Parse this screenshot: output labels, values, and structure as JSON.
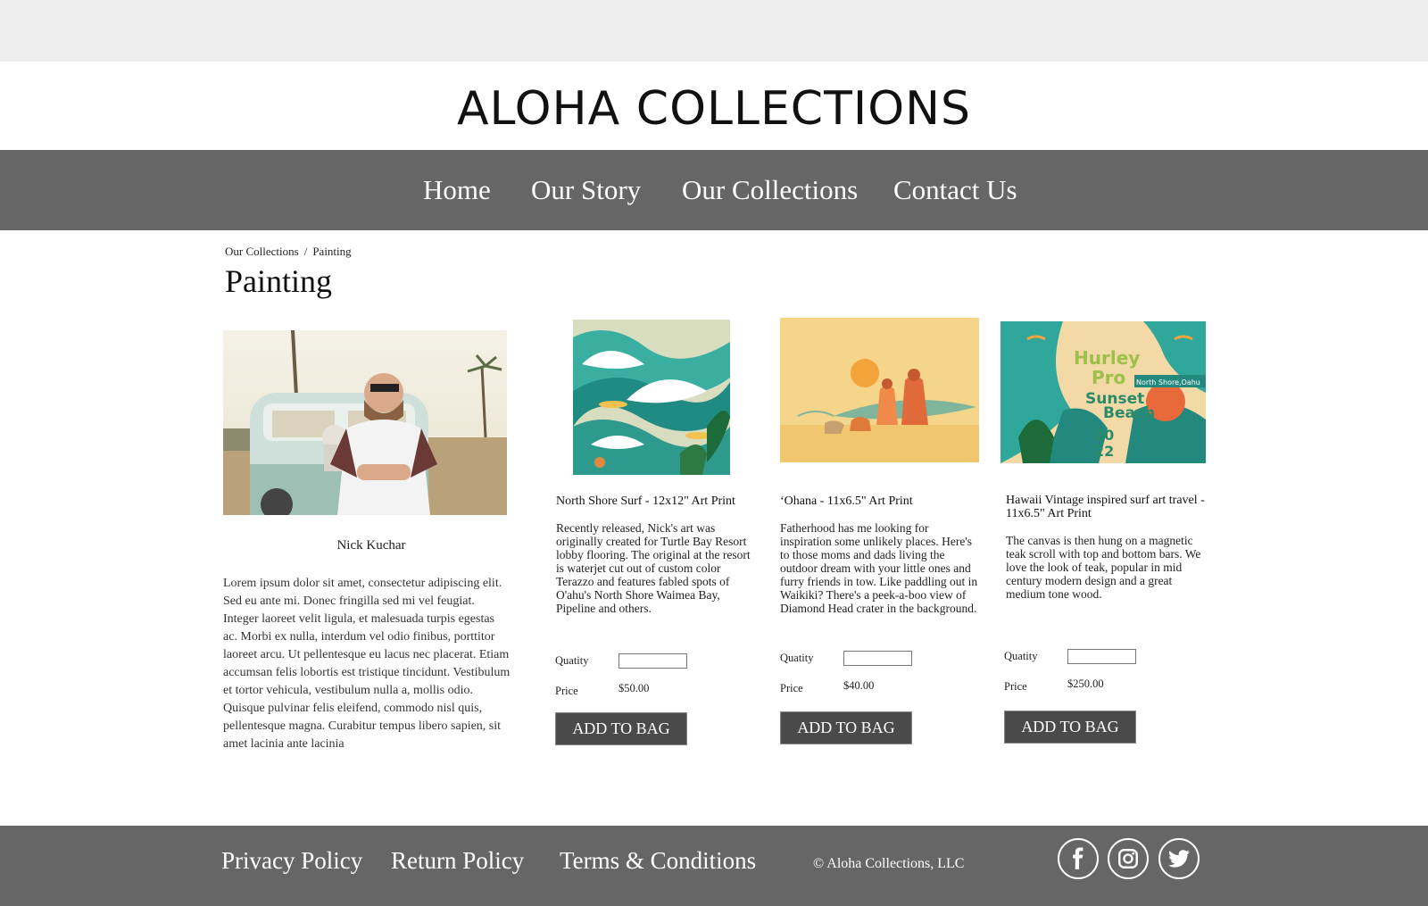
{
  "site": {
    "title": "ALOHA COLLECTIONS"
  },
  "nav": [
    {
      "label": "Home"
    },
    {
      "label": "Our Story"
    },
    {
      "label": "Our Collections"
    },
    {
      "label": "Contact Us"
    }
  ],
  "breadcrumb": {
    "parent": "Our Collections",
    "separator": "/",
    "current": "Painting"
  },
  "page": {
    "title": "Painting"
  },
  "artist": {
    "name": "Nick Kuchar",
    "bio": "Lorem ipsum dolor sit amet, consectetur adipiscing elit. Sed eu ante mi. Donec fringilla sed mi vel feugiat. Integer laoreet velit ligula, et malesuada turpis egestas ac. Morbi ex nulla, interdum vel odio finibus, porttitor laoreet arcu. Ut pellentesque eu lacus nec placerat. Etiam accumsan felis lobortis est tristique tincidunt. Vestibulum et tortor vehicula, vestibulum nulla a, mollis odio. Quisque pulvinar felis eleifend, commodo nisl quis, pellentesque magna. Curabitur tempus libero sapien, sit amet lacinia ante lacinia"
  },
  "products": [
    {
      "title": "North Shore Surf - 12x12\" Art Print",
      "description": "Recently released, Nick's art was originally created for Turtle Bay Resort lobby flooring. The original at the resort is waterjet cut out of custom color Terazzo and  features fabled spots of O'ahu's North Shore Waimea Bay, Pipeline and others.",
      "quantity_label": "Quatity",
      "quantity_value": "",
      "price_label": "Price",
      "price": "$50.00",
      "button": "ADD TO BAG"
    },
    {
      "title": "ʻOhana - 11x6.5\" Art Print",
      "description": "Fatherhood has me looking for inspiration some unlikely places. Here's to those moms and dads living the outdoor dream with your little ones and furry friends in tow. Like paddling out in Waikiki? There's a peek-a-boo view of Diamond Head crater in the background.",
      "quantity_label": "Quatity",
      "quantity_value": "",
      "price_label": "Price",
      "price": "$40.00",
      "button": "ADD TO BAG"
    },
    {
      "title": "Hawaii Vintage inspired surf art travel - 11x6.5\" Art Print",
      "description": "The canvas is then hung on a magnetic teak scroll with top and bottom bars.  We love the look of teak, popular in mid century modern design and a great medium tone wood.",
      "poster_text": {
        "line1": "Hurley",
        "line2": "Pro",
        "line3": "Sunset",
        "line4": "Beach",
        "line5": "20",
        "line6": "22",
        "tag": "North Shore,Oahu"
      },
      "quantity_label": "Quatity",
      "quantity_value": "",
      "price_label": "Price",
      "price": "$250.00",
      "button": "ADD TO BAG"
    }
  ],
  "footer": {
    "links": [
      {
        "label": "Privacy Policy"
      },
      {
        "label": "Return Policy"
      },
      {
        "label": "Terms & Conditions"
      }
    ],
    "copyright": "© Aloha Collections, LLC",
    "social": [
      {
        "icon": "facebook-icon"
      },
      {
        "icon": "instagram-icon"
      },
      {
        "icon": "twitter-icon"
      }
    ]
  },
  "colors": {
    "top_strip": "#eeeeee",
    "nav_bg": "#666666",
    "footer_bg": "#666666",
    "button_bg": "#4a4a4a"
  }
}
